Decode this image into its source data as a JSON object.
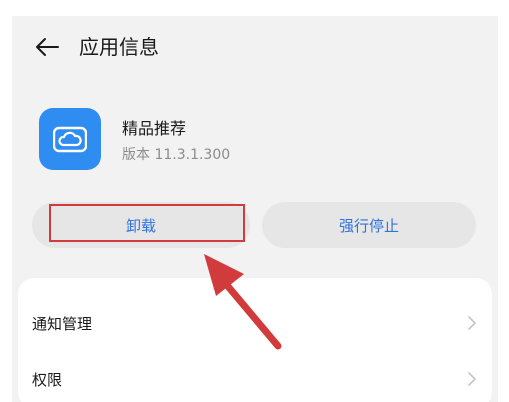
{
  "header": {
    "title": "应用信息",
    "back_icon": "back-arrow-icon"
  },
  "app": {
    "name": "精品推荐",
    "version": "版本 11.3.1.300",
    "icon": "cloud-icon",
    "icon_color": "#2f8cf0"
  },
  "actions": {
    "uninstall_label": "卸载",
    "force_stop_label": "强行停止",
    "accent": "#2f73e0"
  },
  "annotation": {
    "highlight_color": "#d23b3b",
    "arrow_color": "#d23b3b"
  },
  "settings": {
    "items": [
      {
        "label": "通知管理",
        "icon": "chevron-right-icon"
      },
      {
        "label": "权限",
        "icon": "chevron-right-icon"
      }
    ]
  }
}
